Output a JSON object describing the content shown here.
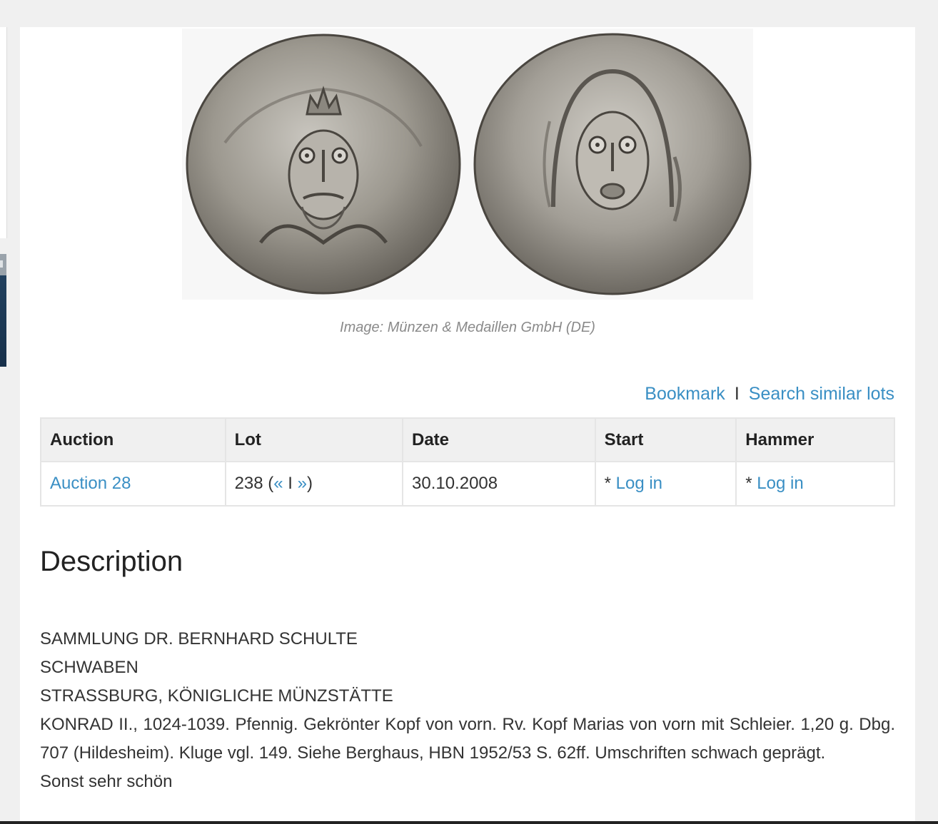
{
  "image": {
    "alt": "Coin obverse and reverse",
    "caption": "Image: Münzen & Medaillen GmbH (DE)"
  },
  "actions": {
    "bookmark": "Bookmark",
    "separator": "I",
    "search_similar": "Search similar lots"
  },
  "table": {
    "headers": {
      "auction": "Auction",
      "lot": "Lot",
      "date": "Date",
      "start": "Start",
      "hammer": "Hammer"
    },
    "row": {
      "auction": "Auction 28",
      "lot_number": "238",
      "lot_open": " (",
      "prev": "«",
      "lot_sep": " I ",
      "next": "»",
      "lot_close": ")",
      "date": "30.10.2008",
      "start_prefix": "* ",
      "start_link": "Log in",
      "hammer_prefix": "* ",
      "hammer_link": "Log in"
    }
  },
  "description": {
    "title": "Description",
    "line1": "SAMMLUNG DR. BERNHARD SCHULTE",
    "line2": "SCHWABEN",
    "line3": "STRASSBURG, KÖNIGLICHE MÜNZSTÄTTE",
    "line4": "KONRAD II., 1024-1039. Pfennig. Gekrönter Kopf von vorn. Rv. Kopf Marias von vorn mit Schleier. 1,20 g. Dbg. 707 (Hildesheim). Kluge vgl. 149. Siehe Berghaus, HBN 1952/53 S. 62ff. Umschriften schwach geprägt.",
    "line5": "Sonst sehr schön"
  },
  "colors": {
    "link": "#3a8fc4",
    "header_bg": "#f0f0f0",
    "coin_silver": "#9b9790"
  }
}
